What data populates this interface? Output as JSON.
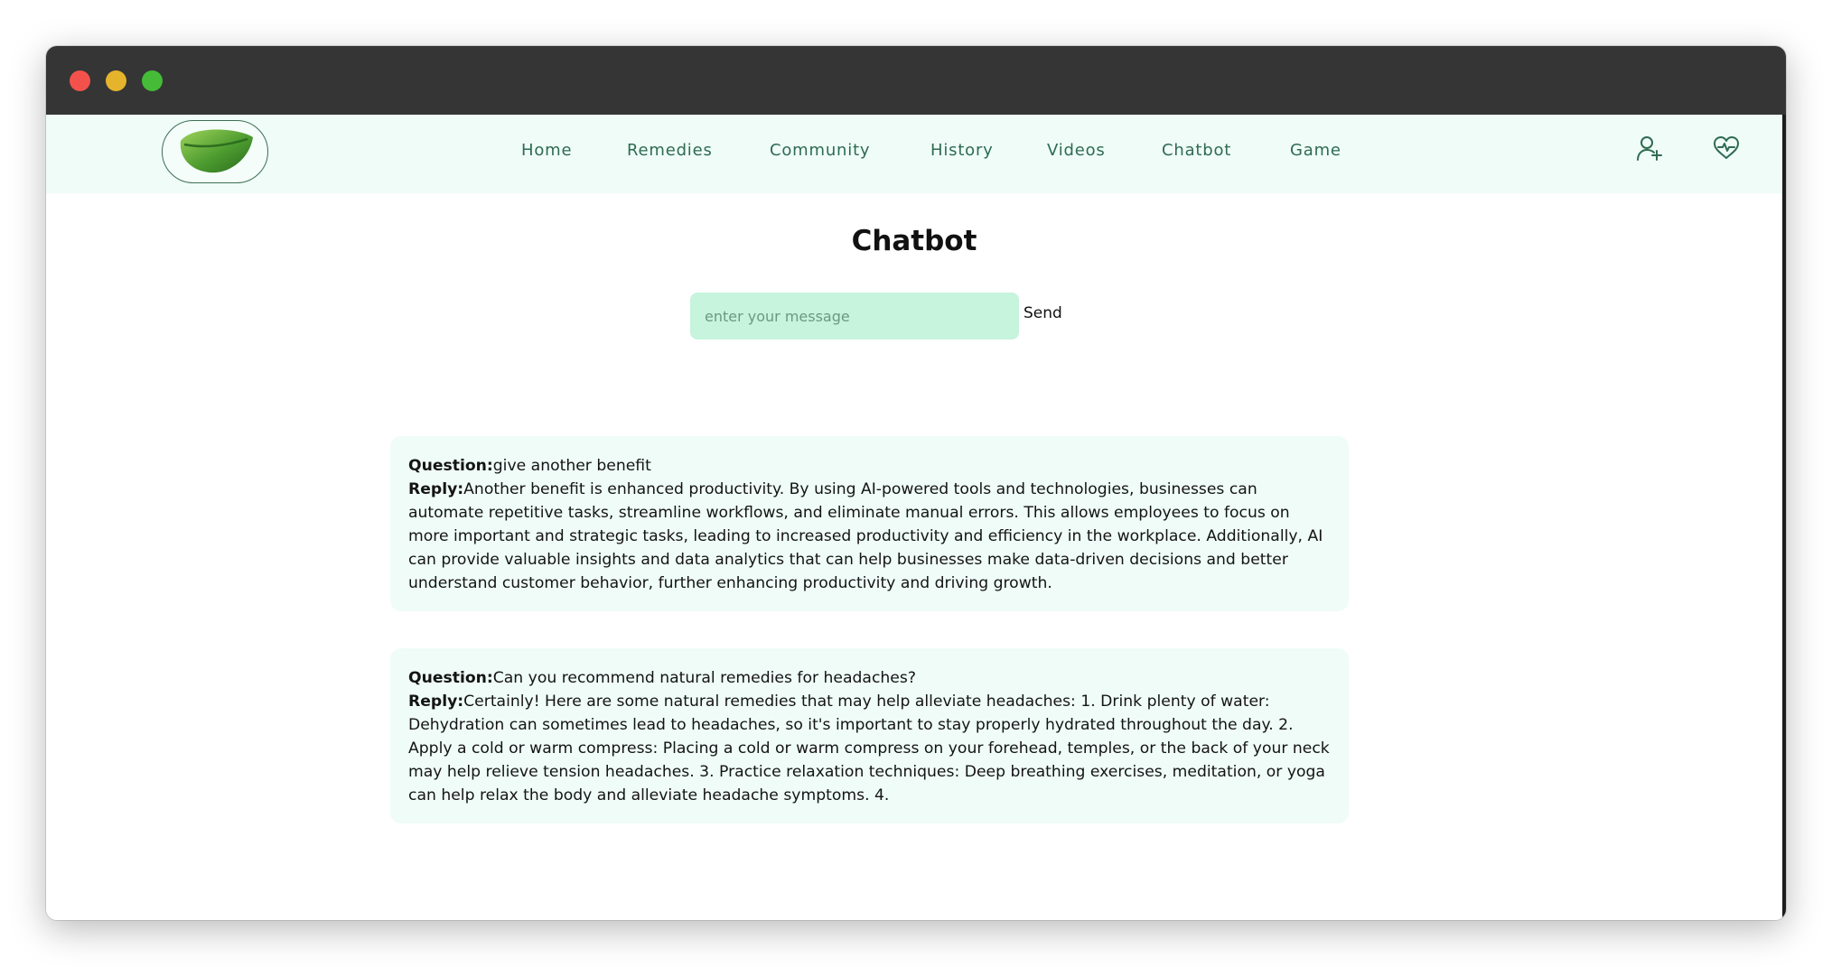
{
  "nav": {
    "links": [
      "Home",
      "Remedies",
      "Community",
      "History",
      "Videos",
      "Chatbot",
      "Game"
    ],
    "icons": [
      "user-plus-icon",
      "heart-pulse-icon"
    ]
  },
  "page": {
    "title": "Chatbot"
  },
  "chat_form": {
    "placeholder": "enter your message",
    "send_label": "Send"
  },
  "labels": {
    "question": "Question:",
    "reply": "Reply:"
  },
  "messages": [
    {
      "question": "give another benefit",
      "reply": "Another benefit is enhanced productivity. By using AI-powered tools and technologies, businesses can automate repetitive tasks, streamline workflows, and eliminate manual errors. This allows employees to focus on more important and strategic tasks, leading to increased productivity and efficiency in the workplace. Additionally, AI can provide valuable insights and data analytics that can help businesses make data-driven decisions and better understand customer behavior, further enhancing productivity and driving growth."
    },
    {
      "question": "Can you recommend natural remedies for headaches?",
      "reply": "Certainly! Here are some natural remedies that may help alleviate headaches: 1. Drink plenty of water: Dehydration can sometimes lead to headaches, so it's important to stay properly hydrated throughout the day. 2. Apply a cold or warm compress: Placing a cold or warm compress on your forehead, temples, or the back of your neck may help relieve tension headaches. 3. Practice relaxation techniques: Deep breathing exercises, meditation, or yoga can help relax the body and alleviate headache symptoms. 4."
    }
  ],
  "colors": {
    "titlebar": "#353535",
    "navbar_bg": "#effcf8",
    "nav_text": "#2f6b52",
    "input_bg": "#c6f4dd",
    "card_bg": "#effcf8"
  }
}
